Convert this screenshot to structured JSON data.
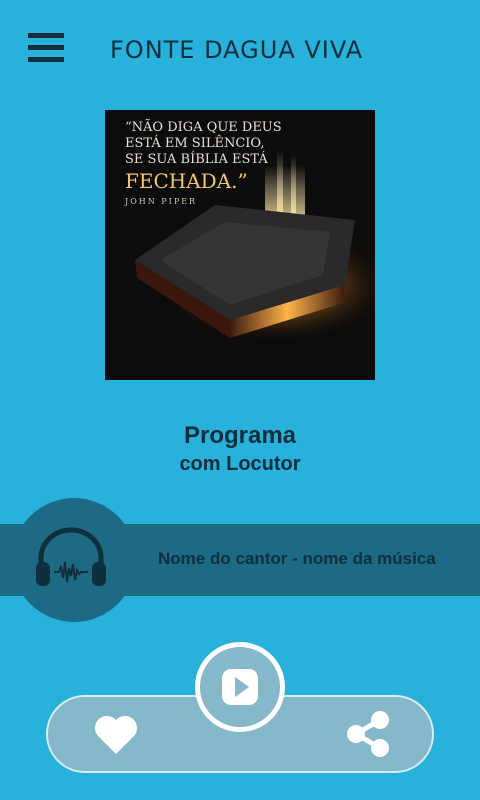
{
  "header": {
    "title": "FONTE DAGUA VIVA",
    "menu_icon": "hamburger-menu-icon"
  },
  "cover": {
    "quote_line1": "“NÃO DIGA QUE DEUS",
    "quote_line2": "ESTÁ EM SILÊNCIO,",
    "quote_line3": "SE SUA BÍBLIA ESTÁ",
    "quote_line4": "FECHADA.”",
    "author": "JOHN PIPER"
  },
  "program": {
    "title": "Programa",
    "subtitle": "com Locutor"
  },
  "now_playing": {
    "track": "Nome do cantor - nome da música",
    "icon": "headphones-icon"
  },
  "controls": {
    "play_icon": "play-icon",
    "like_icon": "heart-icon",
    "share_icon": "share-icon"
  },
  "colors": {
    "background": "#27b1db",
    "band": "#1c6a84",
    "text_dark": "#0f2f3e",
    "control_bar": "#86b8cb"
  }
}
